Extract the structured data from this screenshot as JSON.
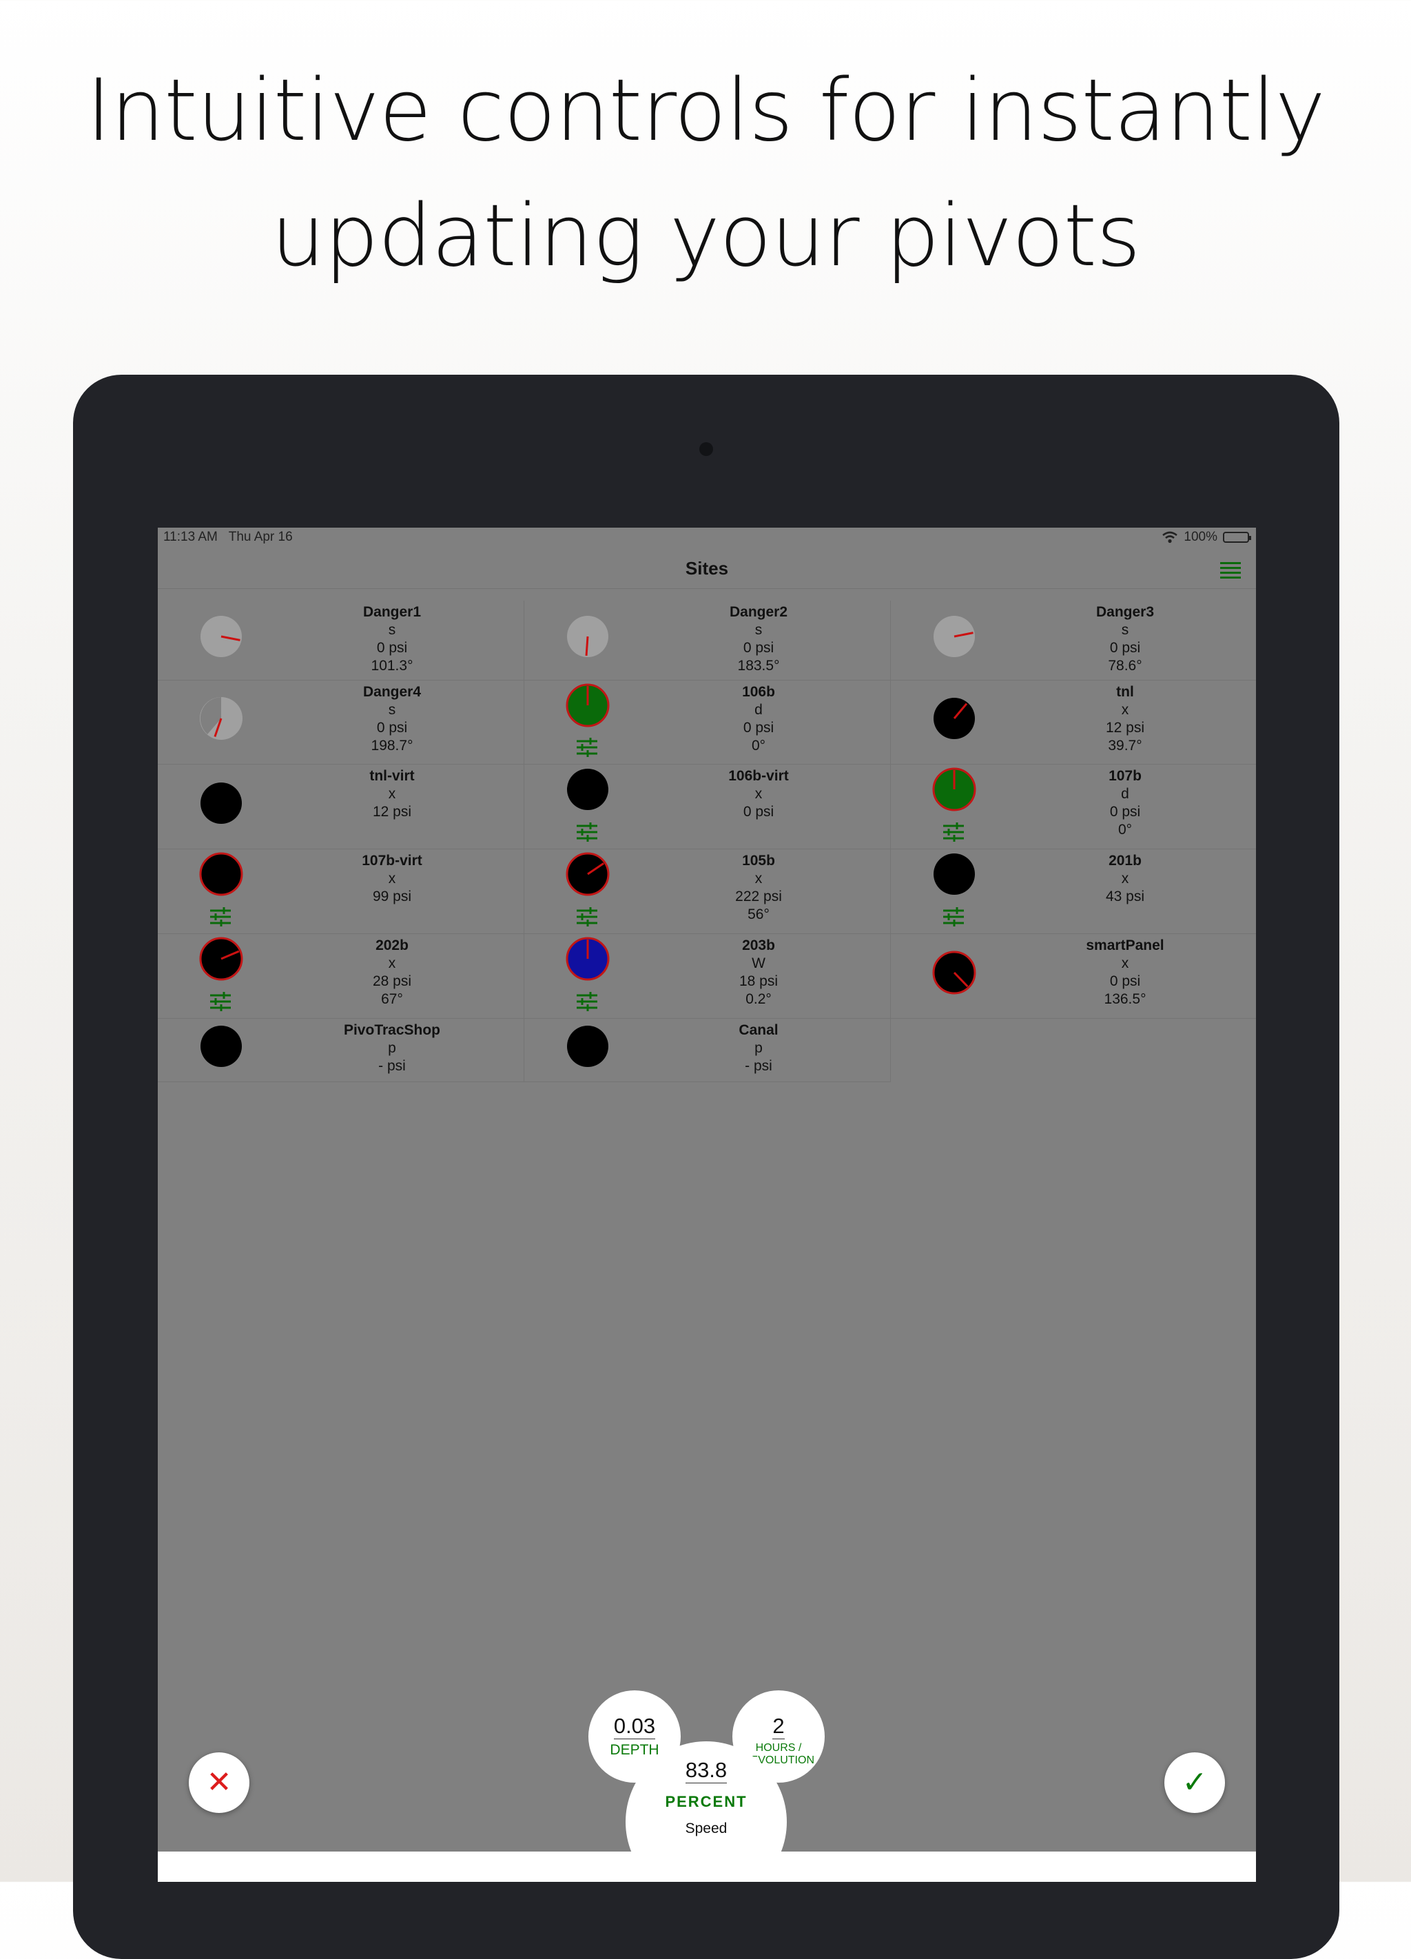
{
  "headline": {
    "line1": "Intuitive controls for instantly",
    "line2": "updating your pivots"
  },
  "status_bar": {
    "time": "11:13 AM",
    "date": "Thu Apr 16",
    "wifi_icon": "wifi-icon",
    "battery_text": "100%",
    "battery_level": 1.0
  },
  "nav": {
    "title": "Sites",
    "menu_icon": "list-menu-icon"
  },
  "sites": [
    {
      "name": "Danger1",
      "mode": "s",
      "pressure": "0 psi",
      "angle": "101.3°"
    },
    {
      "name": "Danger2",
      "mode": "s",
      "pressure": "0 psi",
      "angle": "183.5°"
    },
    {
      "name": "Danger3",
      "mode": "s",
      "pressure": "0 psi",
      "angle": "78.6°"
    },
    {
      "name": "Danger4",
      "mode": "s",
      "pressure": "0 psi",
      "angle": "198.7°"
    },
    {
      "name": "106b",
      "mode": "d",
      "pressure": "0 psi",
      "angle": "0°"
    },
    {
      "name": "tnl",
      "mode": "x",
      "pressure": "12 psi",
      "angle": "39.7°"
    },
    {
      "name": "tnl-virt",
      "mode": "x",
      "pressure": "12 psi",
      "angle": ""
    },
    {
      "name": "106b-virt",
      "mode": "x",
      "pressure": "0 psi",
      "angle": ""
    },
    {
      "name": "107b",
      "mode": "d",
      "pressure": "0 psi",
      "angle": "0°"
    },
    {
      "name": "107b-virt",
      "mode": "x",
      "pressure": "99 psi",
      "angle": ""
    },
    {
      "name": "105b",
      "mode": "x",
      "pressure": "222 psi",
      "angle": "56°"
    },
    {
      "name": "201b",
      "mode": "x",
      "pressure": "43 psi",
      "angle": ""
    },
    {
      "name": "202b",
      "mode": "x",
      "pressure": "28 psi",
      "angle": "67°"
    },
    {
      "name": "203b",
      "mode": "W",
      "pressure": "18 psi",
      "angle": "0.2°"
    },
    {
      "name": "smartPanel",
      "mode": "x",
      "pressure": "0 psi",
      "angle": "136.5°"
    },
    {
      "name": "PivoTracShop",
      "mode": "p",
      "pressure": "- psi",
      "angle": ""
    },
    {
      "name": "Canal",
      "mode": "p",
      "pressure": "- psi",
      "angle": ""
    }
  ],
  "controls": {
    "cancel_icon": "close-icon",
    "confirm_icon": "checkmark-icon",
    "depth": {
      "value": "0.03",
      "label": "DEPTH"
    },
    "hours": {
      "value": "2",
      "label_line1": "HOURS /",
      "label_line2": "REVOLUTION"
    },
    "speed": {
      "value": "83.8",
      "label": "PERCENT",
      "caption": "Speed"
    }
  },
  "colors": {
    "overlay": "#808080",
    "accent_green": "#0b7a0b",
    "pointer_red": "#cc1111",
    "gauge_black": "#000000",
    "gauge_green": "#0a6a0a",
    "gauge_blue": "#1010a0",
    "gauge_idle_gray": "#a0a0a0"
  }
}
